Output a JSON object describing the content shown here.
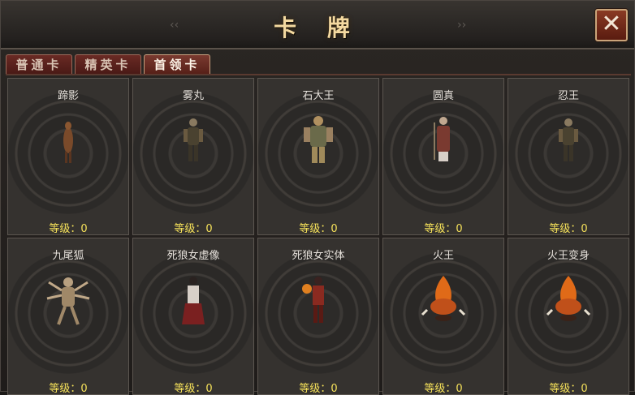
{
  "window": {
    "title": "卡 牌",
    "close_label": "✕"
  },
  "tabs": [
    {
      "label": "普通卡",
      "active": false
    },
    {
      "label": "精英卡",
      "active": false
    },
    {
      "label": "首领卡",
      "active": true
    }
  ],
  "cards": [
    {
      "name": "蹄影",
      "level": "等级：0",
      "figure": "horse-creature"
    },
    {
      "name": "雾丸",
      "level": "等级：0",
      "figure": "ninja"
    },
    {
      "name": "石大王",
      "level": "等级：0",
      "figure": "stone-king"
    },
    {
      "name": "圆真",
      "level": "等级：0",
      "figure": "monk"
    },
    {
      "name": "忍王",
      "level": "等级：0",
      "figure": "ninja-king"
    },
    {
      "name": "九尾狐",
      "level": "等级：0",
      "figure": "nine-tail-fox"
    },
    {
      "name": "死狼女虚像",
      "level": "等级：0",
      "figure": "wolf-woman-phantom"
    },
    {
      "name": "死狼女实体",
      "level": "等级：0",
      "figure": "wolf-woman-body"
    },
    {
      "name": "火王",
      "level": "等级：0",
      "figure": "fire-king"
    },
    {
      "name": "火王变身",
      "level": "等级：0",
      "figure": "fire-king-transformed"
    }
  ]
}
